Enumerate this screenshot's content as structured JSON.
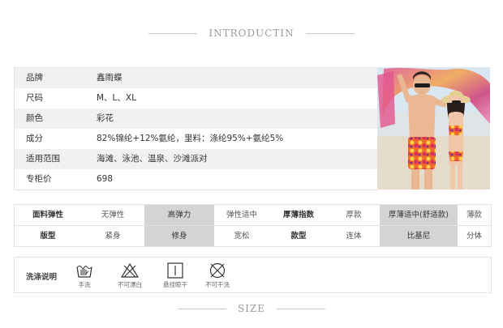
{
  "intro_title": "INTRODUCTIN",
  "size_title": "SIZE",
  "info": [
    {
      "label": "品牌",
      "value": "鑫雨蝶"
    },
    {
      "label": "尺码",
      "value": "M、L、XL"
    },
    {
      "label": "颜色",
      "value": "彩花"
    },
    {
      "label": "成分",
      "value": "82%锦纶+12%氨纶，里料：涤纶95%+氨纶5%"
    },
    {
      "label": "适用范围",
      "value": "海滩、泳池、温泉、沙滩派对"
    },
    {
      "label": "专柜价",
      "value": "698"
    }
  ],
  "attributes": {
    "row1": [
      {
        "text": "面料弹性",
        "head": true,
        "selected": false
      },
      {
        "text": "无弹性",
        "head": false,
        "selected": false
      },
      {
        "text": "高弹力",
        "head": false,
        "selected": true
      },
      {
        "text": "弹性适中",
        "head": false,
        "selected": false
      },
      {
        "text": "厚薄指数",
        "head": true,
        "selected": false
      },
      {
        "text": "厚款",
        "head": false,
        "selected": false
      },
      {
        "text": "厚薄适中(舒适款)",
        "head": false,
        "selected": true
      },
      {
        "text": "薄款",
        "head": false,
        "selected": false
      }
    ],
    "row2": [
      {
        "text": "版型",
        "head": true,
        "selected": false
      },
      {
        "text": "紧身",
        "head": false,
        "selected": false
      },
      {
        "text": "修身",
        "head": false,
        "selected": true
      },
      {
        "text": "宽松",
        "head": false,
        "selected": false
      },
      {
        "text": "款型",
        "head": true,
        "selected": false
      },
      {
        "text": "连体",
        "head": false,
        "selected": false
      },
      {
        "text": "比基尼",
        "head": false,
        "selected": true
      },
      {
        "text": "分体",
        "head": false,
        "selected": false
      }
    ]
  },
  "care": {
    "label": "洗涤说明",
    "items": [
      {
        "icon": "hand-wash-icon",
        "caption": "手洗"
      },
      {
        "icon": "no-bleach-icon",
        "caption": "不可漂白"
      },
      {
        "icon": "hang-dry-icon",
        "caption": "悬挂晾干"
      },
      {
        "icon": "no-dry-clean-icon",
        "caption": "不可干洗"
      }
    ]
  }
}
